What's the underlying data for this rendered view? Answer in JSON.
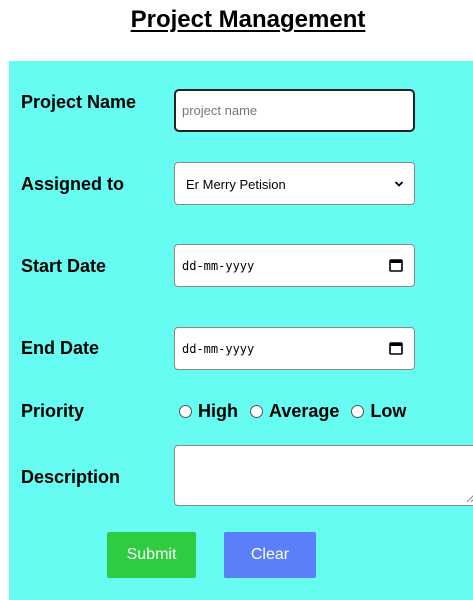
{
  "header": {
    "title": "Project Management"
  },
  "form": {
    "project_name": {
      "label": "Project Name",
      "placeholder": "project name",
      "value": ""
    },
    "assigned_to": {
      "label": "Assigned to",
      "selected": "Er Merry Petision"
    },
    "start_date": {
      "label": "Start Date",
      "value": "dd-mm-yyyy"
    },
    "end_date": {
      "label": "End Date",
      "value": "dd-mm-yyyy"
    },
    "priority": {
      "label": "Priority",
      "options": [
        "High",
        "Average",
        "Low"
      ]
    },
    "description": {
      "label": "Description",
      "value": ""
    }
  },
  "buttons": {
    "submit": "Submit",
    "clear": "Clear"
  },
  "colors": {
    "panel_bg": "#66fcf1",
    "submit_bg": "#2ecc40",
    "clear_bg": "#5b7ff7"
  }
}
